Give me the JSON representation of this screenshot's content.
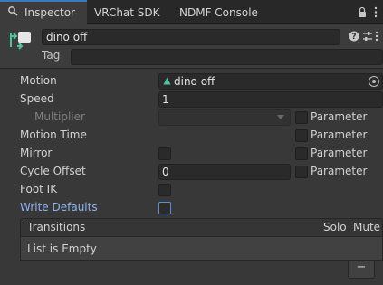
{
  "tabs": [
    {
      "label": "Inspector",
      "active": true
    },
    {
      "label": "VRChat SDK",
      "active": false
    },
    {
      "label": "NDMF Console",
      "active": false
    }
  ],
  "header": {
    "object_name": "dino off",
    "tag_label": "Tag",
    "tag_value": ""
  },
  "properties": {
    "motion_label": "Motion",
    "motion_value": "dino off",
    "speed_label": "Speed",
    "speed_value": "1",
    "multiplier_label": "Multiplier",
    "motion_time_label": "Motion Time",
    "mirror_label": "Mirror",
    "cycle_offset_label": "Cycle Offset",
    "cycle_offset_value": "0",
    "foot_ik_label": "Foot IK",
    "write_defaults_label": "Write Defaults",
    "parameter_label": "Parameter"
  },
  "transitions": {
    "title": "Transitions",
    "solo_label": "Solo",
    "mute_label": "Mute",
    "empty_text": "List is Empty",
    "remove_label": "−"
  },
  "colors": {
    "background": "#383838",
    "accent_tab": "#3a79bb",
    "link_text": "#8fb4f0",
    "animation_icon": "#4fc3a1"
  }
}
